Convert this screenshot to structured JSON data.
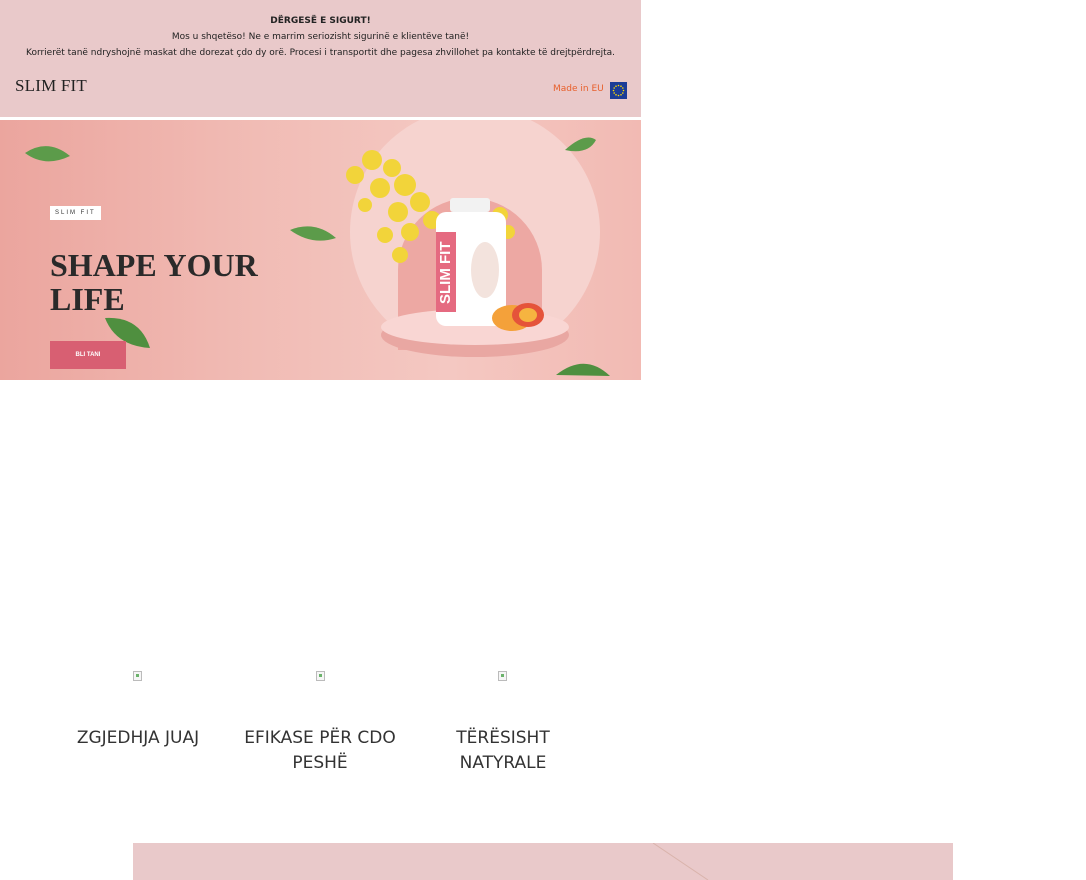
{
  "notice": {
    "title": "DËRGESË E SIGURT!",
    "line1": "Mos u shqetëso! Ne e marrim seriozisht sigurinë e klientëve tanë!",
    "line2": "Korrierët tanë ndryshojnë maskat dhe dorezat çdo dy orë. Procesi i transportit dhe pagesa zhvillohet pa kontakte të drejtpërdrejta."
  },
  "header": {
    "brand": "SLIM FIT",
    "made_in": "Made in EU",
    "flag_icon": "eu-flag-icon"
  },
  "hero": {
    "tag": "SLIM FIT",
    "title_line1": "SHAPE YOUR",
    "title_line2": "LIFE",
    "cta": "BLI TANI",
    "bottle_label": "SLIM FIT"
  },
  "features": [
    {
      "label_line1": "ZGJEDHJA JUAJ",
      "label_line2": ""
    },
    {
      "label_line1": "EFIKASE PËR CDO",
      "label_line2": "PESHË"
    },
    {
      "label_line1": "TËRËSISHT",
      "label_line2": "NATYRALE"
    }
  ],
  "colors": {
    "notice_bg": "#e9c9ca",
    "cta_bg": "#d85f72",
    "made_in_text": "#e8602c",
    "eu_flag": "#1b3c97"
  }
}
